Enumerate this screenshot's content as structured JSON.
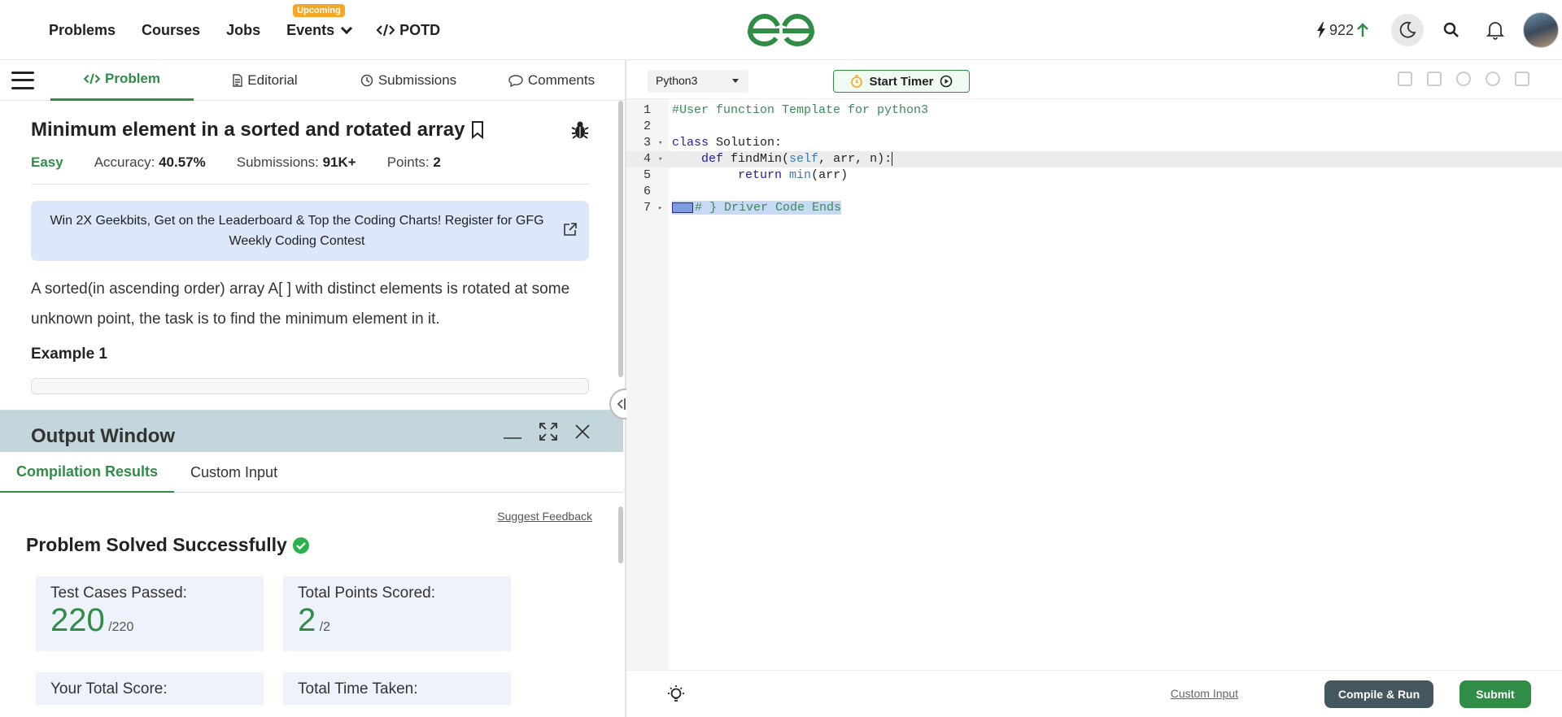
{
  "nav": {
    "problems": "Problems",
    "courses": "Courses",
    "jobs": "Jobs",
    "events": "Events",
    "events_badge": "Upcoming",
    "potd": "POTD",
    "streak": "922"
  },
  "tabs": {
    "problem": "Problem",
    "editorial": "Editorial",
    "submissions": "Submissions",
    "comments": "Comments"
  },
  "problem": {
    "title": "Minimum element in a sorted and rotated array",
    "difficulty": "Easy",
    "accuracy_label": "Accuracy: ",
    "accuracy": "40.57%",
    "submissions_label": "Submissions: ",
    "submissions": "91K+",
    "points_label": "Points: ",
    "points": "2",
    "banner": "Win 2X Geekbits, Get on the Leaderboard & Top the Coding Charts! Register for GFG Weekly Coding Contest",
    "description": "A sorted(in ascending order) array A[ ] with distinct elements is rotated at some unknown point, the task is to find the minimum element in it.",
    "example_heading": "Example 1"
  },
  "output": {
    "title": "Output Window",
    "tab_results": "Compilation Results",
    "tab_custom": "Custom Input",
    "suggest": "Suggest Feedback",
    "status": "Problem Solved Successfully",
    "cards": {
      "tests_label": "Test Cases Passed:",
      "tests_value": "220",
      "tests_total": "/220",
      "points_label": "Total Points Scored:",
      "points_value": "2",
      "points_total": "/2",
      "score_label": "Your Total Score:",
      "time_label": "Total Time Taken:"
    }
  },
  "editor": {
    "language": "Python3",
    "timer": "Start Timer",
    "lines": [
      "1",
      "2",
      "3",
      "4",
      "5",
      "6",
      "7"
    ],
    "code": {
      "l1": "#User function Template for python3",
      "l3_kw": "class",
      "l3_rest": " Solution:",
      "l4_indent": "    ",
      "l4_kw": "def",
      "l4_name": " findMin(",
      "l4_self": "self",
      "l4_rest": ", arr, n):",
      "l5_indent": "         ",
      "l5_kw": "return",
      "l5_space": " ",
      "l5_min": "min",
      "l5_rest": "(arr)",
      "l7": "# } Driver Code Ends"
    },
    "custom_input": "Custom Input",
    "compile_run": "Compile & Run",
    "submit": "Submit"
  },
  "colors": {
    "brand_green": "#2f8d46",
    "output_header": "#c3d6db",
    "banner_bg": "#dde7fa",
    "run_button": "#44575f"
  }
}
